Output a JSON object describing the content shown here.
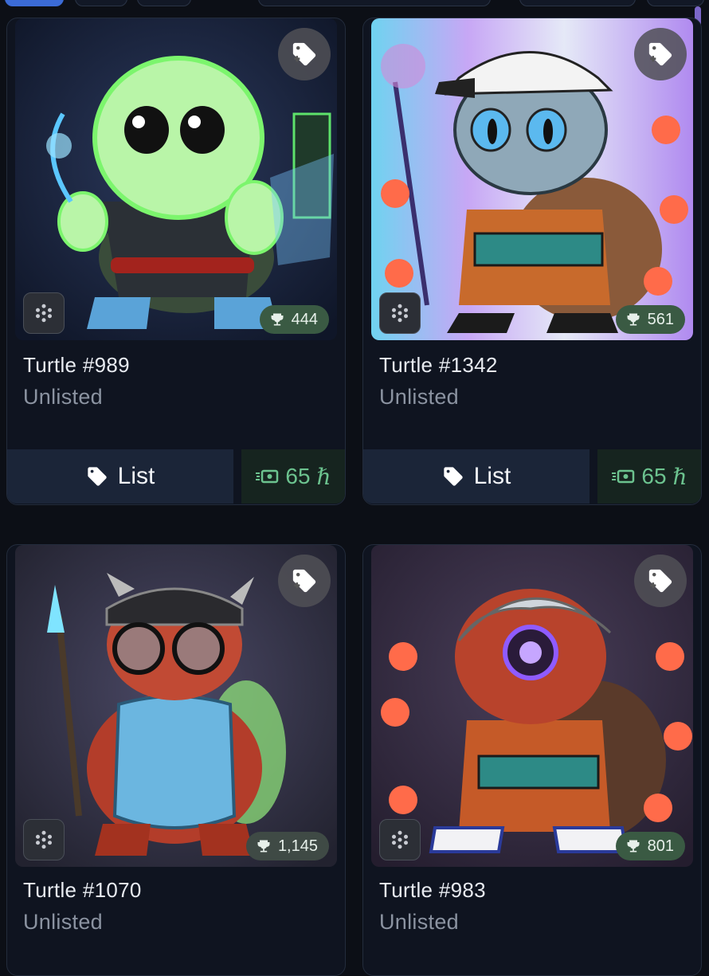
{
  "cards": [
    {
      "name": "Turtle #989",
      "status": "Unlisted",
      "rank": "444",
      "list_label": "List",
      "price": "65",
      "currency": "ℏ"
    },
    {
      "name": "Turtle #1342",
      "status": "Unlisted",
      "rank": "561",
      "list_label": "List",
      "price": "65",
      "currency": "ℏ"
    },
    {
      "name": "Turtle #1070",
      "status": "Unlisted",
      "rank": "1,145"
    },
    {
      "name": "Turtle #983",
      "status": "Unlisted",
      "rank": "801"
    }
  ],
  "icons": {
    "tag_add": "tag-plus-icon",
    "chain": "hex-network-icon",
    "rank": "trophy-icon",
    "list": "tag-icon",
    "price": "cash-icon"
  },
  "colors": {
    "background": "#0c0f16",
    "card": "#0f1420",
    "rank_badge": "#3a5a43",
    "price_text": "#6cc38f",
    "list_button": "#1b2538",
    "scroll_thumb": "#7b67c8"
  }
}
